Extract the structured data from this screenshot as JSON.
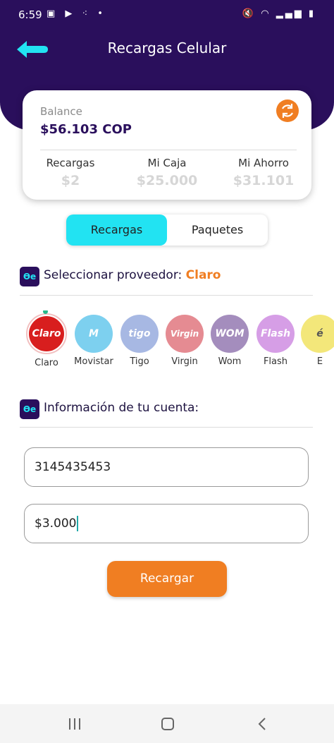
{
  "status_bar": {
    "time": "6:59"
  },
  "header": {
    "title": "Recargas Celular"
  },
  "balance": {
    "label": "Balance",
    "value": "$56.103  COP",
    "stats": [
      {
        "label": "Recargas",
        "value": "$2"
      },
      {
        "label": "Mi Caja",
        "value": "$25.000"
      },
      {
        "label": "Mi Ahorro",
        "value": "$31.101"
      }
    ]
  },
  "tabs": [
    {
      "label": "Recargas",
      "active": true
    },
    {
      "label": "Paquetes",
      "active": false
    }
  ],
  "provider_section": {
    "title": "Seleccionar proveedor: ",
    "selected": "Claro"
  },
  "providers": [
    {
      "name": "Claro",
      "logo_text": "Claro",
      "color": "#d81e1e",
      "selected": true
    },
    {
      "name": "Movistar",
      "logo_text": "M",
      "color": "#7dd0ef",
      "selected": false
    },
    {
      "name": "Tigo",
      "logo_text": "tigo",
      "color": "#a7b8e3",
      "selected": false
    },
    {
      "name": "Virgin",
      "logo_text": "Virgin",
      "color": "#e58b92",
      "selected": false
    },
    {
      "name": "Wom",
      "logo_text": "WOM",
      "color": "#a48dbd",
      "selected": false
    },
    {
      "name": "Flash",
      "logo_text": "Flash",
      "color": "#d69ee6",
      "selected": false
    },
    {
      "name": "E",
      "logo_text": "é",
      "color": "#f3e77a",
      "selected": false
    }
  ],
  "account_section": {
    "title": "Información de tu cuenta:"
  },
  "form": {
    "phone_value": "3145435453",
    "amount_value": "$3.000"
  },
  "actions": {
    "recargar_label": "Recargar"
  },
  "colors": {
    "header_bg": "#2a0f5c",
    "accent_cyan": "#22e3f2",
    "accent_orange": "#f07e22"
  }
}
